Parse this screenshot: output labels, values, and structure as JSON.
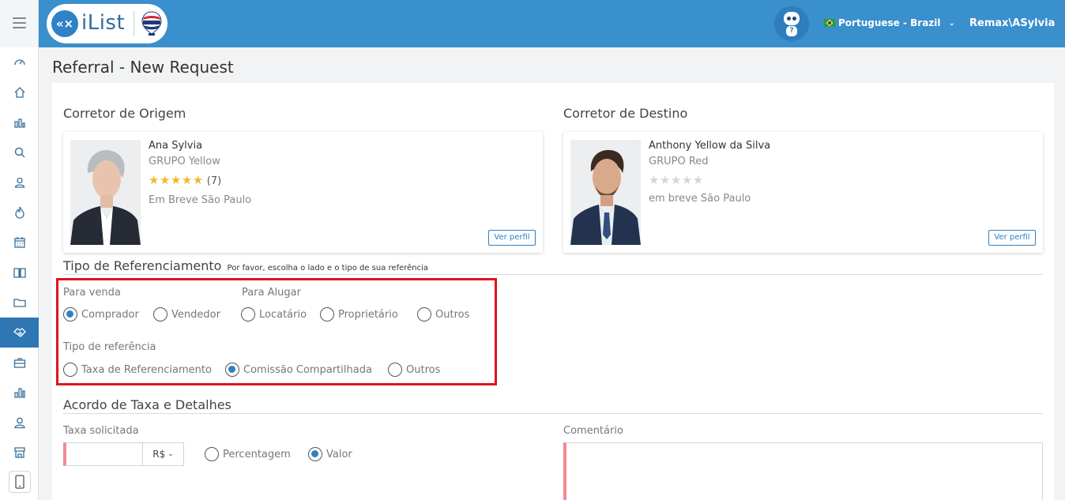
{
  "header": {
    "brand_mark": "«×",
    "brand": "iList",
    "language": "Portuguese - Brazil",
    "user": "Remax\\ASylvia",
    "robot_badge": "?"
  },
  "sidebar": {
    "items": [
      {
        "icon": "dashboard-icon"
      },
      {
        "icon": "home-icon"
      },
      {
        "icon": "bar-chart-icon"
      },
      {
        "icon": "search-icon"
      },
      {
        "icon": "contacts-icon"
      },
      {
        "icon": "flame-icon"
      },
      {
        "icon": "calendar-icon"
      },
      {
        "icon": "book-icon"
      },
      {
        "icon": "folder-icon"
      },
      {
        "icon": "handshake-icon",
        "active": true
      },
      {
        "icon": "briefcase-icon"
      },
      {
        "icon": "stats-icon"
      },
      {
        "icon": "user-icon"
      },
      {
        "icon": "store-icon"
      }
    ],
    "phone_icon": "mobile-icon"
  },
  "page": {
    "title": "Referral - New Request"
  },
  "origin": {
    "section_title": "Corretor de Origem",
    "name": "Ana Sylvia",
    "group": "GRUPO Yellow",
    "rating_filled": 5,
    "rating_count": "(7)",
    "location": "Em Breve São Paulo",
    "profile_button": "Ver perfil"
  },
  "destination": {
    "section_title": "Corretor de Destino",
    "name": "Anthony Yellow da Silva",
    "group": "GRUPO Red",
    "rating_filled": 0,
    "location": "em breve São Paulo",
    "profile_button": "Ver perfil"
  },
  "referral_type": {
    "title": "Tipo de Referenciamento",
    "hint": "Por favor, escolha o lado e o tipo de sua referência",
    "sale_label": "Para venda",
    "rent_label": "Para Alugar",
    "side_options": [
      {
        "label": "Comprador",
        "checked": true
      },
      {
        "label": "Vendedor",
        "checked": false
      },
      {
        "label": "Locatário",
        "checked": false
      },
      {
        "label": "Proprietário",
        "checked": false
      },
      {
        "label": "Outros",
        "checked": false
      }
    ],
    "kind_label": "Tipo de referência",
    "kind_options": [
      {
        "label": "Taxa de Referenciamento",
        "checked": false
      },
      {
        "label": "Comissão Compartilhada",
        "checked": true
      },
      {
        "label": "Outros",
        "checked": false
      }
    ]
  },
  "fee": {
    "title": "Acordo de Taxa e Detalhes",
    "requested_label": "Taxa solicitada",
    "value": "",
    "currency": "R$",
    "mode_options": [
      {
        "label": "Percentagem",
        "checked": false
      },
      {
        "label": "Valor",
        "checked": true
      }
    ],
    "comment_label": "Comentário",
    "comment": ""
  },
  "colors": {
    "header": "#3a8fcd",
    "active_sidebar": "#2e77b4",
    "accent": "#2f80c2",
    "highlight_box": "#e3131c",
    "required_marker": "#f08a8f",
    "star": "#f0b92a"
  }
}
